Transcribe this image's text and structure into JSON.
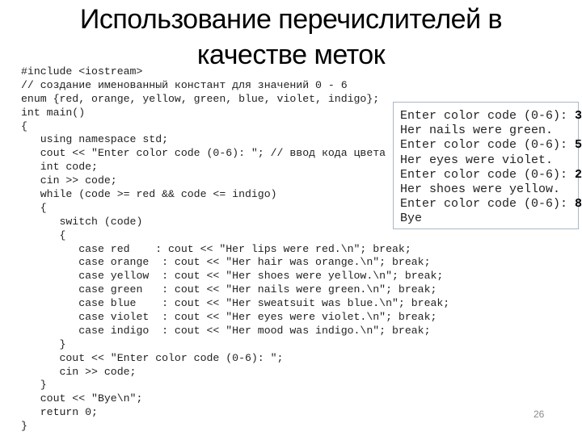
{
  "slide": {
    "title_line1": "Использование перечислителей в",
    "title_line2": "качестве меток",
    "page_number": "26"
  },
  "code_lines": [
    "#include <iostream>",
    "// создание именованный констант для значений 0 - 6",
    "enum {red, orange, yellow, green, blue, violet, indigo};",
    "int main()",
    "{",
    "   using namespace std;",
    "   cout << \"Enter color code (0-6): \"; // ввод кода цвета",
    "   int code;",
    "   cin >> code;",
    "   while (code >= red && code <= indigo)",
    "   {",
    "      switch (code)",
    "      {",
    "         case red    : cout << \"Her lips were red.\\n\"; break;",
    "         case orange  : cout << \"Her hair was orange.\\n\"; break;",
    "         case yellow  : cout << \"Her shoes were yellow.\\n\"; break;",
    "         case green   : cout << \"Her nails were green.\\n\"; break;",
    "         case blue    : cout << \"Her sweatsuit was blue.\\n\"; break;",
    "         case violet  : cout << \"Her eyes were violet.\\n\"; break;",
    "         case indigo  : cout << \"Her mood was indigo.\\n\"; break;",
    "      }",
    "      cout << \"Enter color code (0-6): \";",
    "      cin >> code;",
    "   }",
    "   cout << \"Bye\\n\";",
    "   return 0;",
    "}"
  ],
  "console_output": [
    {
      "text": "Enter color code (0-6): ",
      "input": "3"
    },
    {
      "text": "Her nails were green.",
      "input": ""
    },
    {
      "text": "Enter color code (0-6): ",
      "input": "5"
    },
    {
      "text": "Her eyes were violet.",
      "input": ""
    },
    {
      "text": "Enter color code (0-6): ",
      "input": "2"
    },
    {
      "text": "Her shoes were yellow.",
      "input": ""
    },
    {
      "text": "Enter color code (0-6): ",
      "input": "8"
    },
    {
      "text": "Bye",
      "input": ""
    }
  ],
  "colors": {
    "console_border": "#a9b8c6",
    "code_text": "#222222",
    "page_number": "#8a8a8a"
  }
}
